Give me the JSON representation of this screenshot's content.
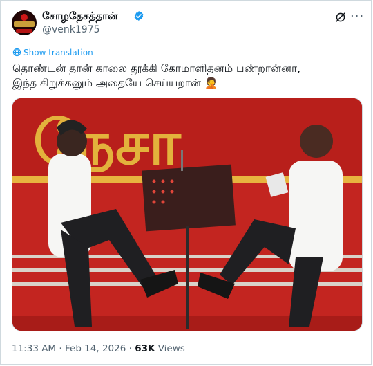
{
  "author": {
    "display_name": "சோழதேசத்தான்",
    "handle": "@venk1975",
    "verified": true,
    "verified_color": "#1d9bf0"
  },
  "header_actions": {
    "grok_icon": "grok-icon",
    "more_icon": "more-icon",
    "more_label": "···"
  },
  "translate": {
    "label": "Show translation",
    "icon": "translate-icon"
  },
  "tweet": {
    "line1": "தொண்டன் தான் காலை தூக்கி கோமாளிதனம் பண்றான்னா,",
    "line2": "இந்த கிறுக்கனும் அதையே செய்யறான்",
    "emoji": "🤦"
  },
  "media": {
    "type": "photo",
    "banner_text": "நேசா"
  },
  "meta": {
    "time": "11:33 AM",
    "separator": "·",
    "date": "Feb 14, 2026",
    "views_count": "63K",
    "views_label": "Views"
  },
  "colors": {
    "link": "#1d9bf0",
    "secondary_text": "#536471",
    "primary_text": "#0f1419",
    "border": "#cfd9de"
  }
}
